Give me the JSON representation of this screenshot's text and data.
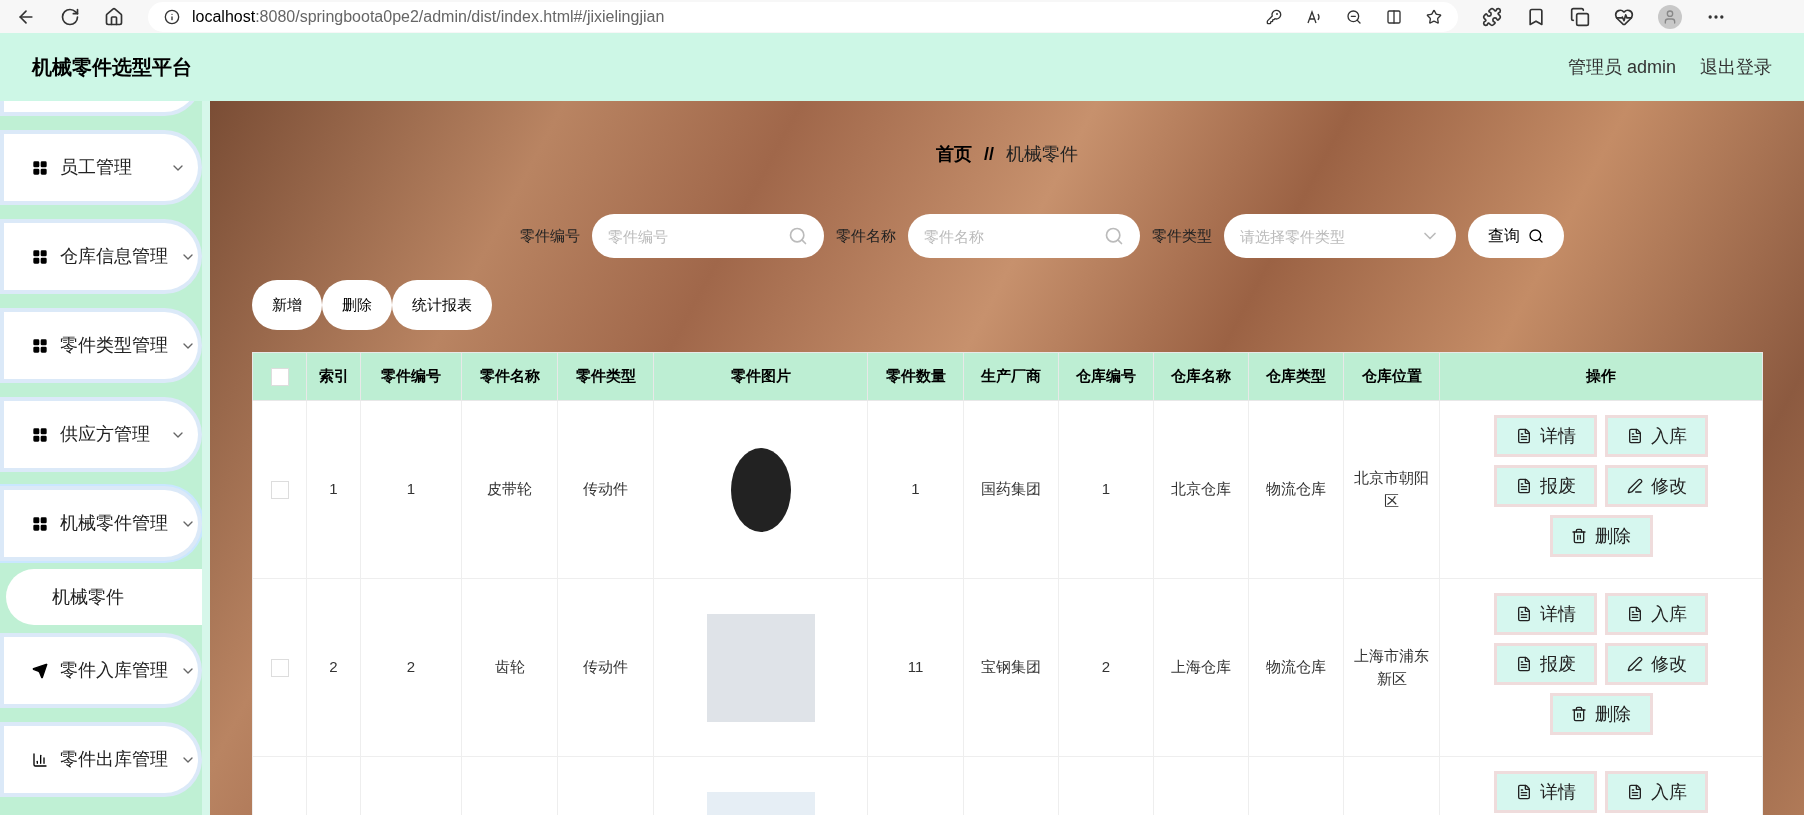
{
  "browser": {
    "url_host": "localhost",
    "url_rest": ":8080/springboota0pe2/admin/dist/index.html#/jixielingjian"
  },
  "header": {
    "title": "机械零件选型平台",
    "user": "管理员 admin",
    "logout": "退出登录"
  },
  "sidebar": {
    "items": [
      {
        "expanded": false
      },
      {
        "label": "员工管理",
        "expanded": false
      },
      {
        "label": "仓库信息管理",
        "expanded": false
      },
      {
        "label": "零件类型管理",
        "expanded": false
      },
      {
        "label": "供应方管理",
        "expanded": false
      },
      {
        "label": "机械零件管理",
        "expanded": true,
        "children": [
          {
            "label": "机械零件",
            "selected": true
          }
        ]
      },
      {
        "label": "零件入库管理",
        "expanded": false
      },
      {
        "label": "零件出库管理",
        "expanded": false
      }
    ]
  },
  "breadcrumb": {
    "home": "首页",
    "separator": "//",
    "current": "机械零件"
  },
  "search": {
    "fields": [
      {
        "kind": "text",
        "label": "零件编号",
        "placeholder": "零件编号"
      },
      {
        "kind": "text",
        "label": "零件名称",
        "placeholder": "零件名称"
      },
      {
        "kind": "select",
        "label": "零件类型",
        "placeholder": "请选择零件类型"
      }
    ],
    "button": "查询"
  },
  "toolbar": [
    "新增",
    "删除",
    "统计报表"
  ],
  "table": {
    "columns": [
      "索引",
      "零件编号",
      "零件名称",
      "零件类型",
      "零件图片",
      "零件数量",
      "生产厂商",
      "仓库编号",
      "仓库名称",
      "仓库类型",
      "仓库位置",
      "操作"
    ],
    "header_checked": false,
    "rows": [
      {
        "checked": false,
        "cells": [
          "1",
          "1",
          "皮带轮",
          "传动件",
          null,
          "1",
          "国药集团",
          "1",
          "北京仓库",
          "物流仓库",
          "北京市朝阳区"
        ],
        "actions": [
          "详情",
          "入库",
          "报废",
          "修改",
          "删除"
        ]
      },
      {
        "checked": false,
        "cells": [
          "2",
          "2",
          "齿轮",
          "传动件",
          null,
          "11",
          "宝钢集团",
          "2",
          "上海仓库",
          "物流仓库",
          "上海市浦东新区"
        ],
        "actions": [
          "详情",
          "入库",
          "报废",
          "修改",
          "删除"
        ]
      },
      {
        "actions": [
          "详情",
          "入库"
        ]
      }
    ]
  }
}
